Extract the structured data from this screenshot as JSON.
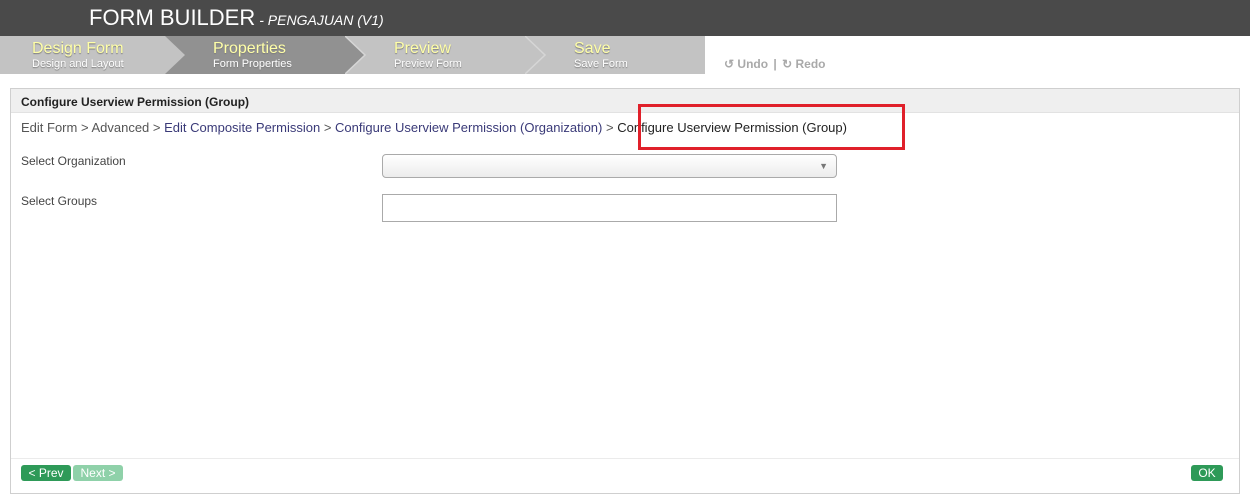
{
  "header": {
    "title": "FORM BUILDER",
    "subtitle": "- PENGAJUAN (V1)"
  },
  "steps": [
    {
      "title": "Design Form",
      "subtitle": "Design and Layout"
    },
    {
      "title": "Properties",
      "subtitle": "Form Properties"
    },
    {
      "title": "Preview",
      "subtitle": "Preview Form"
    },
    {
      "title": "Save",
      "subtitle": "Save Form"
    }
  ],
  "toolbar": {
    "undo_label": "Undo",
    "separator": "|",
    "redo_label": "Redo"
  },
  "panel": {
    "title": "Configure Userview Permission (Group)",
    "breadcrumb": {
      "edit_form": "Edit Form",
      "sep": ">",
      "advanced": "Advanced",
      "edit_composite": "Edit Composite Permission",
      "configure_org": "Configure Userview Permission (Organization)",
      "current": "Configure Userview Permission (Group)"
    },
    "fields": {
      "organization_label": "Select Organization",
      "organization_value": "",
      "groups_label": "Select Groups",
      "groups_value": ""
    }
  },
  "buttons": {
    "prev": "< Prev",
    "next": "Next >",
    "ok": "OK"
  },
  "colors": {
    "topbar": "#4a4a4a",
    "active_step": "#919191",
    "inactive_step": "#c3c3c3",
    "highlight": "#e0202a",
    "primary_button": "#2e9a58"
  }
}
